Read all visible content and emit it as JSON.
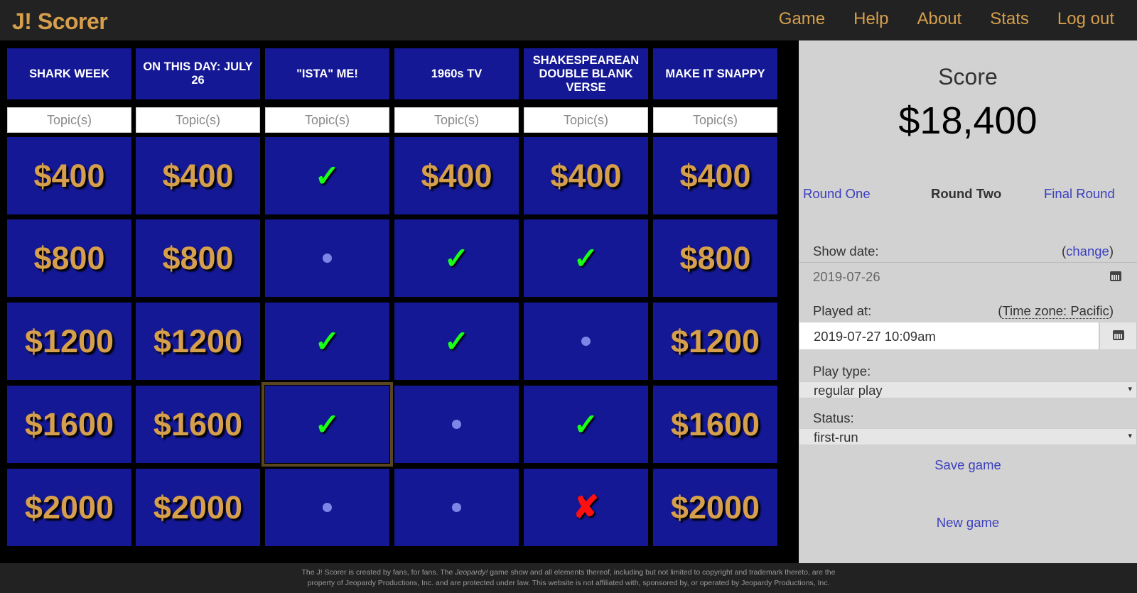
{
  "nav": {
    "brand": "J! Scorer",
    "links": [
      "Game",
      "Help",
      "About",
      "Stats",
      "Log out"
    ]
  },
  "board": {
    "categories": [
      "SHARK WEEK",
      "ON THIS DAY: JULY 26",
      "\"ISTA\" ME!",
      "1960s TV",
      "SHAKESPEAREAN DOUBLE BLANK VERSE",
      "MAKE IT SNAPPY"
    ],
    "topic_placeholder": "Topic(s)",
    "rows": [
      [
        "$400",
        "$400",
        "check",
        "$400",
        "$400",
        "$400"
      ],
      [
        "$800",
        "$800",
        "dot",
        "check",
        "check",
        "$800"
      ],
      [
        "$1200",
        "$1200",
        "check",
        "check",
        "dot",
        "$1200"
      ],
      [
        "$1600",
        "$1600",
        "check",
        "dot",
        "check",
        "$1600"
      ],
      [
        "$2000",
        "$2000",
        "dot",
        "dot",
        "cross",
        "$2000"
      ]
    ],
    "check_glyph": "✓",
    "cross_glyph": "✘"
  },
  "panel": {
    "score_title": "Score",
    "score_value": "$18,400",
    "rounds": [
      "Round One",
      "Round Two",
      "Final Round"
    ],
    "active_round": "Round Two",
    "show_date_label": "Show date:",
    "change_paren_open": "(",
    "change_link": "change",
    "change_paren_close": ")",
    "show_date_value": "2019-07-26",
    "played_at_label": "Played at:",
    "timezone_paren_open": "(",
    "timezone": "Time zone: Pacific",
    "timezone_paren_close": ")",
    "played_at_value": "2019-07-27 10:09am",
    "play_type_label": "Play type:",
    "play_type_value": "regular play",
    "status_label": "Status:",
    "status_value": "first-run",
    "dropdown_arrow": "▾",
    "save_button": "Save game",
    "new_button": "New game"
  },
  "footer": {
    "line1_a": "The J! Scorer is created by fans, for fans. The ",
    "line1_em": "Jeopardy!",
    "line1_b": " game show and all elements thereof, including but not limited to copyright and trademark thereto, are the",
    "line2": "property of Jeopardy Productions, Inc. and are protected under law. This website is not affiliated with, sponsored by, or operated by Jeopardy Productions, Inc."
  },
  "colors": {
    "board_blue": "#141894",
    "gold": "#d69f4c",
    "check_green": "#18ff18",
    "cross_red": "#ff1010",
    "link_blue": "#3a3fbd"
  }
}
